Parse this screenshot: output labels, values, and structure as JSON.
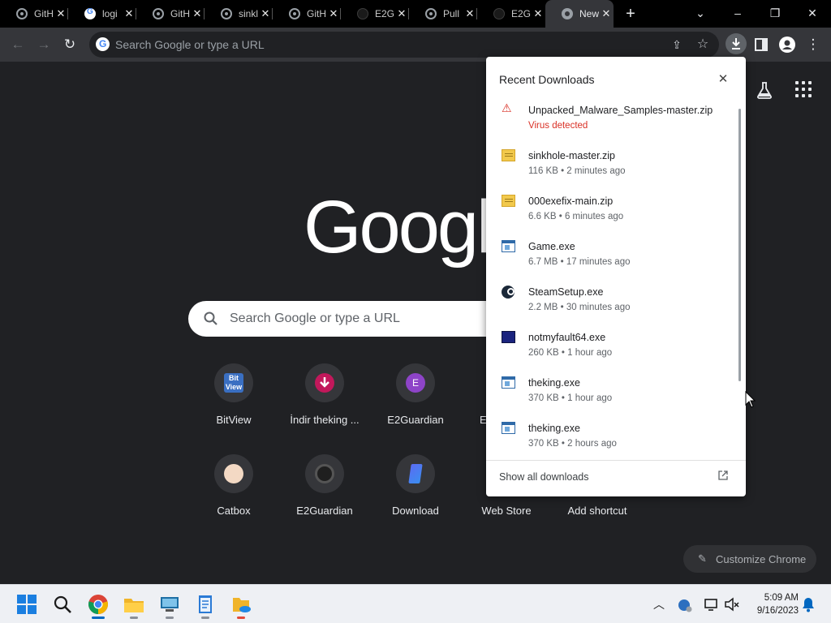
{
  "tabs": [
    {
      "title": "GitH",
      "favicon": "github-icon"
    },
    {
      "title": "logi",
      "favicon": "google-icon"
    },
    {
      "title": "GitH",
      "favicon": "github-icon"
    },
    {
      "title": "sinkl",
      "favicon": "github-icon"
    },
    {
      "title": "GitH",
      "favicon": "github-icon"
    },
    {
      "title": "E2G",
      "favicon": "e2guardian-icon"
    },
    {
      "title": "Pull",
      "favicon": "github-icon"
    },
    {
      "title": "E2G",
      "favicon": "e2guardian-icon"
    },
    {
      "title": "New",
      "favicon": "chrome-icon",
      "active": true
    }
  ],
  "toolbar": {
    "omnibox_placeholder": "Search Google or type a URL"
  },
  "ntp": {
    "logo_text": "Google",
    "search_placeholder": "Search Google or type a URL",
    "shortcuts": [
      {
        "label": "BitView",
        "icon": "bitview-icon"
      },
      {
        "label": "İndir theking ...",
        "icon": "download-arrow-icon"
      },
      {
        "label": "E2Guardian",
        "icon": "letter-e-icon",
        "letter": "E"
      },
      {
        "label": "E",
        "icon": "hidden-shortcut-icon"
      },
      {
        "label": "Catbox",
        "icon": "catbox-icon"
      },
      {
        "label": "E2Guardian",
        "icon": "github-icon"
      },
      {
        "label": "Download",
        "icon": "download-site-icon"
      },
      {
        "label": "Web Store",
        "icon": "web-store-icon"
      },
      {
        "label": "Add shortcut",
        "icon": "plus-icon"
      }
    ],
    "customize_label": "Customize Chrome"
  },
  "downloads": {
    "title": "Recent Downloads",
    "items": [
      {
        "name": "Unpacked_Malware_Samples-master.zip",
        "meta": "Virus detected",
        "icon": "virus-warning-icon",
        "danger": true
      },
      {
        "name": "sinkhole-master.zip",
        "meta": "116 KB • 2 minutes ago",
        "icon": "zip-file-icon"
      },
      {
        "name": "000exefix-main.zip",
        "meta": "6.6 KB • 6 minutes ago",
        "icon": "zip-file-icon"
      },
      {
        "name": "Game.exe",
        "meta": "6.7 MB • 17 minutes ago",
        "icon": "exe-file-icon"
      },
      {
        "name": "SteamSetup.exe",
        "meta": "2.2 MB • 30 minutes ago",
        "icon": "steam-icon"
      },
      {
        "name": "notmyfault64.exe",
        "meta": "260 KB • 1 hour ago",
        "icon": "notmyfault-icon"
      },
      {
        "name": "theking.exe",
        "meta": "370 KB • 1 hour ago",
        "icon": "exe-file-icon"
      },
      {
        "name": "theking.exe",
        "meta": "370 KB • 2 hours ago",
        "icon": "exe-file-icon"
      }
    ],
    "show_all": "Show all downloads"
  },
  "taskbar": {
    "time": "5:09 AM",
    "date": "9/16/2023"
  }
}
